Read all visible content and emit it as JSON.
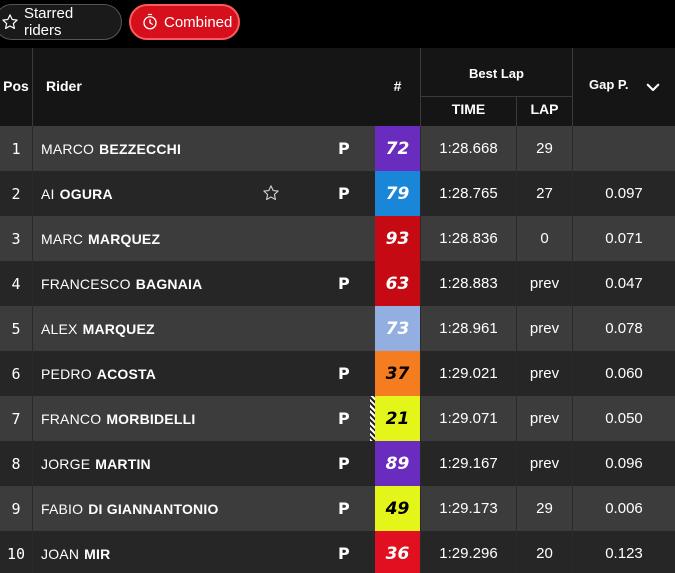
{
  "filters": {
    "starred_label": "Starred riders",
    "combined_label": "Combined",
    "combined_color": "#d50f1c"
  },
  "header": {
    "pos": "Pos",
    "rider": "Rider",
    "number": "#",
    "best_lap": "Best Lap",
    "time": "TIME",
    "lap": "LAP",
    "gap": "Gap P.",
    "sort_icon": "chevron-down-icon"
  },
  "rows": [
    {
      "pos": "1",
      "first": "MARCO",
      "last": "BEZZECCHI",
      "p": "P",
      "starred": false,
      "number": "72",
      "num_bg": "#6a2bbf",
      "num_fg": "#ffffff",
      "time": "1:28.668",
      "lap": "29",
      "gap": ""
    },
    {
      "pos": "2",
      "first": "AI",
      "last": "OGURA",
      "p": "P",
      "starred": true,
      "number": "79",
      "num_bg": "#1a86d8",
      "num_fg": "#ffffff",
      "time": "1:28.765",
      "lap": "27",
      "gap": "0.097"
    },
    {
      "pos": "3",
      "first": "MARC",
      "last": "MARQUEZ",
      "p": "",
      "starred": false,
      "number": "93",
      "num_bg": "#c50a14",
      "num_fg": "#ffffff",
      "time": "1:28.836",
      "lap": "0",
      "gap": "0.071"
    },
    {
      "pos": "4",
      "first": "FRANCESCO",
      "last": "BAGNAIA",
      "p": "P",
      "starred": false,
      "number": "63",
      "num_bg": "#c50a14",
      "num_fg": "#ffffff",
      "time": "1:28.883",
      "lap": "prev",
      "gap": "0.047"
    },
    {
      "pos": "5",
      "first": "ALEX",
      "last": "MARQUEZ",
      "p": "",
      "starred": false,
      "number": "73",
      "num_bg": "#93aee0",
      "num_fg": "#ffffff",
      "time": "1:28.961",
      "lap": "prev",
      "gap": "0.078"
    },
    {
      "pos": "6",
      "first": "PEDRO",
      "last": "ACOSTA",
      "p": "P",
      "starred": false,
      "number": "37",
      "num_bg": "#f57c1f",
      "num_fg": "#000000",
      "time": "1:29.021",
      "lap": "prev",
      "gap": "0.060"
    },
    {
      "pos": "7",
      "first": "FRANCO",
      "last": "MORBIDELLI",
      "p": "P",
      "starred": false,
      "number": "21",
      "num_bg": "#e4f51a",
      "num_fg": "#000000",
      "time": "1:29.071",
      "lap": "prev",
      "gap": "0.050",
      "checker": true
    },
    {
      "pos": "8",
      "first": "JORGE",
      "last": "MARTIN",
      "p": "P",
      "starred": false,
      "number": "89",
      "num_bg": "#6a2bbf",
      "num_fg": "#ffffff",
      "time": "1:29.167",
      "lap": "prev",
      "gap": "0.096"
    },
    {
      "pos": "9",
      "first": "FABIO",
      "last": "DI GIANNANTONIO",
      "p": "P",
      "starred": false,
      "number": "49",
      "num_bg": "#e4f51a",
      "num_fg": "#000000",
      "time": "1:29.173",
      "lap": "29",
      "gap": "0.006"
    },
    {
      "pos": "10",
      "first": "JOAN",
      "last": "MIR",
      "p": "P",
      "starred": false,
      "number": "36",
      "num_bg": "#e01020",
      "num_fg": "#ffffff",
      "time": "1:29.296",
      "lap": "20",
      "gap": "0.123"
    }
  ]
}
